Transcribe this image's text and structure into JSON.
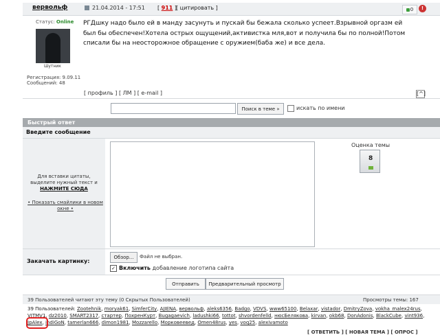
{
  "post": {
    "author": "вервольф",
    "date": "21.04.2014 - 17:51",
    "number_prefix": "[",
    "number": "911",
    "number_suffix": "]",
    "quote": "[ цитировать ]",
    "rating_value": "0",
    "warn_icon": "warning-icon",
    "text": "РГДшку надо было ей в манду засунуть и пускай бы бежала сколько успеет.Взрывной оргазм ей был бы обеспечен!Хотела острых ощущений,активистка мля,вот и получила бы по полной!Потом списали бы на неосторожное обращение с оружием(баба же) и все дела.",
    "links": "[ профиль ] [ ЛМ ] [ e-mail ]",
    "to_top": "[^]"
  },
  "profile": {
    "status_label": "Статус:",
    "status_value": "Online",
    "avatar_caption": "Шутник",
    "registration": "Регистрация: 9.09.11",
    "messages": "Сообщений: 48"
  },
  "search": {
    "button": "Поиск в теме »",
    "checkbox_label": "искать по имени"
  },
  "quick_reply": {
    "title": "Быстрый ответ",
    "enter_message": "Введите сообщение",
    "hint_line": "Для вставки цитаты, выделите нужный текст и",
    "hint_action": "НАЖМИТЕ СЮДА",
    "smilies": "• Показать смайлики в новом окне •",
    "theme_rating_label": "Оценка темы",
    "theme_rating_value": "8"
  },
  "attach": {
    "label": "Закачать картинку:",
    "file_button": "Обзор...",
    "file_status": "Файл не выбран.",
    "logo_check": "✓",
    "logo_bold": "Включить",
    "logo_rest": " добавление логотипа сайта"
  },
  "actions": {
    "send": "Отправить",
    "preview": "Предварительный просмотр"
  },
  "readers": {
    "title": "39 Пользователей читают эту тему (0 Скрытых Пользователей)",
    "views": "Просмотры темы: 167",
    "list_prefix": "39 Пользователей:",
    "users": [
      "Zootehnik",
      "moryak61",
      "SimferCity",
      "AJIENA",
      "вервольф",
      "aleks6356",
      "Badgo",
      "VDVS",
      "www65100",
      "Belaxar",
      "vistador",
      "DmitryZova",
      "vokha_malex24rus",
      "VITMV1",
      "dz2010",
      "SMART2317",
      "стартер",
      "ПохренКурт",
      "Bugagaevich",
      "ladushki66",
      "tottot",
      "shvordenfelld",
      "нюсБелякова",
      "kirvan",
      "okb68",
      "DonAdonis",
      "BlackCube",
      "vint936",
      "JpAlex",
      "indiGoN",
      "tamerlan666",
      "dimon1981",
      "Mozzarello",
      "Морковеевед",
      "Omen48rus",
      "yes",
      "voq25",
      "alexivamoto"
    ],
    "bottom_links": "[ ОТВЕТИТЬ ]  [ НОВАЯ ТЕМА ]  [ ОПРОС ]"
  }
}
